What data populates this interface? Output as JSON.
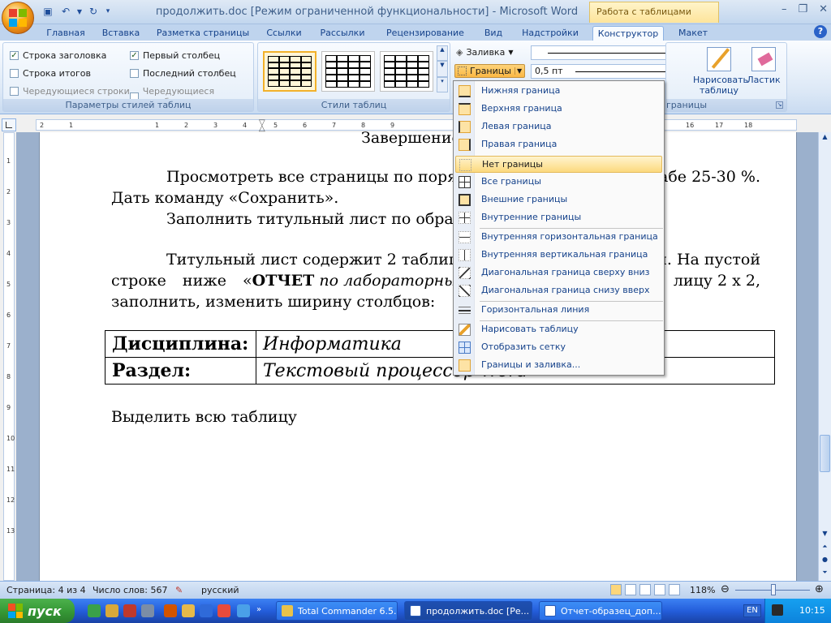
{
  "window": {
    "title": "продолжить.doc [Режим ограниченной функциональности] - Microsoft Word",
    "context_tab_header": "Работа с таблицами",
    "controls": [
      "–",
      "❐",
      "✕"
    ]
  },
  "tabs": [
    "Главная",
    "Вставка",
    "Разметка страницы",
    "Ссылки",
    "Рассылки",
    "Рецензирование",
    "Вид",
    "Надстройки",
    "Конструктор",
    "Макет"
  ],
  "active_tab": "Конструктор",
  "ribbon": {
    "style_options": {
      "label": "Параметры стилей таблиц",
      "header_row": "Строка заголовка",
      "total_row": "Строка итогов",
      "banded_rows": "Чередующиеся строки",
      "first_column": "Первый столбец",
      "last_column": "Последний столбец",
      "banded_columns": "Чередующиеся столбцы",
      "checked": {
        "header_row": true,
        "total_row": false,
        "banded_rows": false,
        "first_column": true,
        "last_column": false,
        "banded_columns": false
      }
    },
    "table_styles": {
      "label": "Стили таблиц"
    },
    "shading": "Заливка",
    "borders": "Границы",
    "line_weight": "0,5 пт",
    "draw_group_label": "границы",
    "draw_table": "Нарисовать таблицу",
    "eraser": "Ластик"
  },
  "ruler": {
    "h_ticks": [
      "2",
      "1",
      "1",
      "2",
      "3",
      "4",
      "5",
      "6",
      "7",
      "8",
      "9",
      "16",
      "17",
      "18"
    ],
    "v_ticks": [
      "1",
      "2",
      "3",
      "4",
      "5",
      "6",
      "7",
      "8",
      "9",
      "10",
      "11",
      "12",
      "13"
    ]
  },
  "document": {
    "heading_fragment": "Завершение",
    "p1_line1": "Просмотреть все страницы по поряд",
    "p1_line1_end": "абе 25-30 %.",
    "p1_line2": "Дать команду «Сохранить».",
    "p2_line1": "Заполнить титульный лист по образц",
    "p3_line1_start": "Титульный лист содержит 2 таблиц",
    "p3_line1_end": "и. На пустой",
    "p3_line2_start": "строке ниже «",
    "p3_line2_bold": "ОТЧЕТ",
    "p3_line2_italic": " по лабораторным",
    "p3_line2_end": "лицу 2 х 2,",
    "p3_line3": "заполнить, изменить ширину столбцов:",
    "table": [
      {
        "key": "Дисциплина:",
        "value": "Информатика"
      },
      {
        "key": "Раздел:",
        "value": "Текстовый процессор Word"
      }
    ],
    "p4": "Выделить всю таблицу"
  },
  "borders_menu": {
    "items": [
      {
        "label": "Нижняя граница",
        "icon": "bottom-border-icon"
      },
      {
        "label": "Верхняя граница",
        "icon": "top-border-icon"
      },
      {
        "label": "Левая граница",
        "icon": "left-border-icon"
      },
      {
        "label": "Правая граница",
        "icon": "right-border-icon"
      },
      {
        "label": "Нет границы",
        "icon": "no-border-icon"
      },
      {
        "label": "Все границы",
        "icon": "all-borders-icon"
      },
      {
        "label": "Внешние границы",
        "icon": "outside-borders-icon"
      },
      {
        "label": "Внутренние границы",
        "icon": "inside-borders-icon"
      },
      {
        "label": "Внутренняя горизонтальная граница",
        "icon": "inside-horizontal-border-icon"
      },
      {
        "label": "Внутренняя вертикальная граница",
        "icon": "inside-vertical-border-icon"
      },
      {
        "label": "Диагональная граница сверху вниз",
        "icon": "diagonal-down-border-icon"
      },
      {
        "label": "Диагональная граница снизу вверх",
        "icon": "diagonal-up-border-icon"
      },
      {
        "label": "Горизонтальная линия",
        "icon": "horizontal-line-icon"
      },
      {
        "label": "Нарисовать таблицу",
        "icon": "draw-table-icon"
      },
      {
        "label": "Отобразить сетку",
        "icon": "view-gridlines-icon"
      },
      {
        "label": "Границы и заливка...",
        "icon": "borders-shading-icon"
      }
    ],
    "highlighted": "Нет границы"
  },
  "statusbar": {
    "page": "Страница: 4 из 4",
    "words": "Число слов: 567",
    "language": "русский",
    "zoom": "118%"
  },
  "taskbar": {
    "start": "пуск",
    "tasks": [
      "Total Commander 6.5...",
      "продолжить.doc [Ре...",
      "Отчет-образец_доп..."
    ],
    "active_task": 1,
    "language": "EN",
    "clock": "10:15"
  },
  "colors": {
    "accent": "#15428b",
    "highlight": "#fcd97e",
    "taskbar": "#245edb"
  }
}
